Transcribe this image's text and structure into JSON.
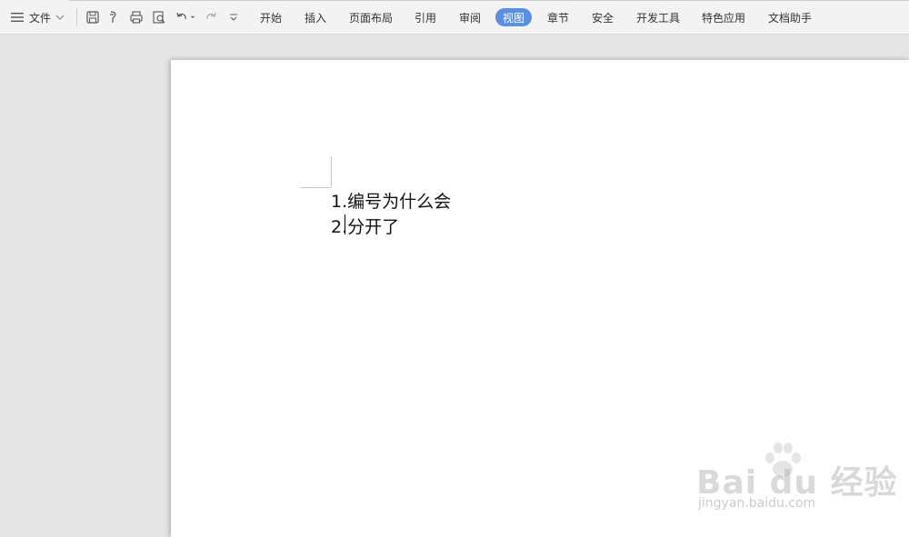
{
  "toolbar": {
    "file_label": "文件",
    "quick_icons": [
      "save-icon",
      "format-painter-icon",
      "print-icon",
      "print-preview-icon",
      "undo-icon",
      "undo-dropdown-icon",
      "redo-icon",
      "customize-dropdown-icon"
    ],
    "tabs": [
      {
        "label": "开始"
      },
      {
        "label": "插入"
      },
      {
        "label": "页面布局"
      },
      {
        "label": "引用"
      },
      {
        "label": "审阅"
      },
      {
        "label": "视图",
        "active": true
      },
      {
        "label": "章节"
      },
      {
        "label": "安全"
      },
      {
        "label": "开发工具"
      },
      {
        "label": "特色应用"
      },
      {
        "label": "文档助手"
      }
    ],
    "active_tab_color": "#5b8fdf"
  },
  "document": {
    "lines": [
      {
        "number": "1.",
        "text": "编号为什么会"
      },
      {
        "number": "2.",
        "text": "分开了"
      }
    ]
  },
  "watermark": {
    "brand": "Bai du 经验",
    "url": "jingyan.baidu.com"
  }
}
